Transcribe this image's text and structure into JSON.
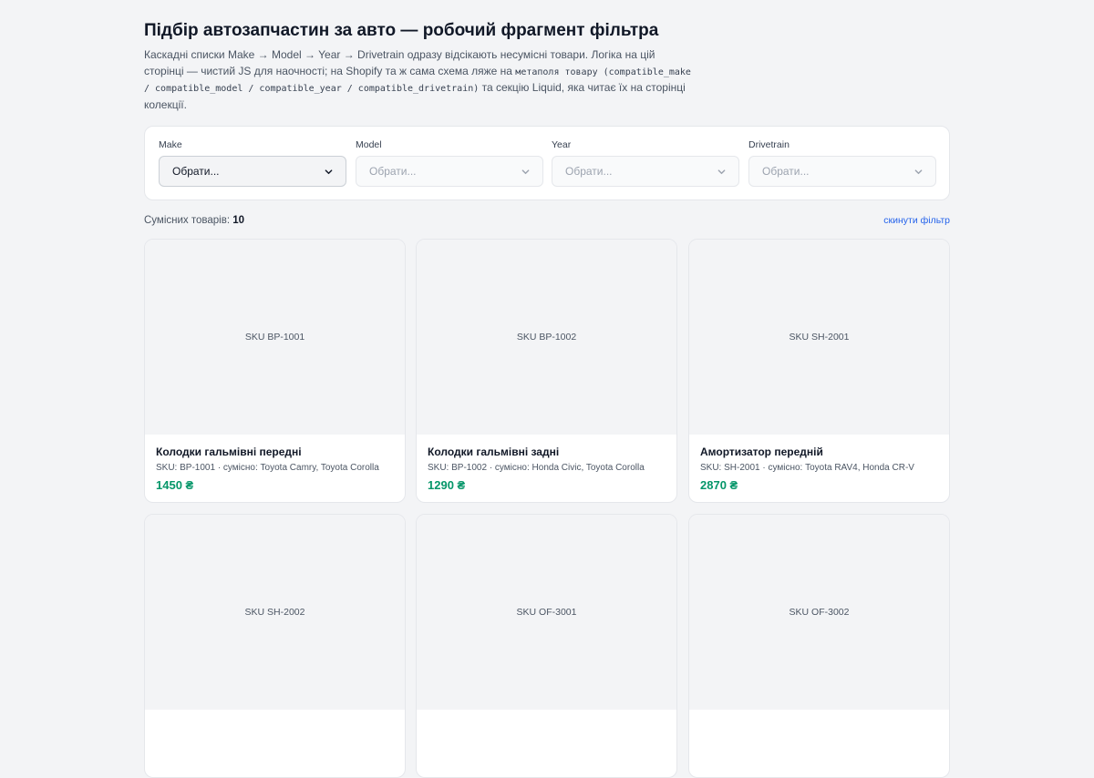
{
  "header": {
    "title": "Підбір автозапчастин за авто — робочий фрагмент фільтра",
    "desc_part1": "Каскадні списки Make → Model → Year → Drivetrain одразу відсікають несумісні товари. Логіка на цій сторінці — чистий JS для наочності; на Shopify та ж сама схема ляже на ",
    "desc_code": "метаполя товару (compatible_make / compatible_model / compatible_year / compatible_drivetrain)",
    "desc_part2": " та секцію Liquid, яка читає їх на сторінці колекції."
  },
  "filters": [
    {
      "label": "Make",
      "value": "Обрати...",
      "active": true
    },
    {
      "label": "Model",
      "value": "Обрати...",
      "active": false
    },
    {
      "label": "Year",
      "value": "Обрати...",
      "active": false
    },
    {
      "label": "Drivetrain",
      "value": "Обрати...",
      "active": false
    }
  ],
  "summary": {
    "label": "Сумісних товарів: ",
    "count": "10",
    "reset": "скинути фільтр"
  },
  "products": [
    {
      "thumb": "SKU BP-1001",
      "title": "Колодки гальмівні передні",
      "meta": "SKU: BP-1001 · сумісно: Toyota Camry, Toyota Corolla",
      "price": "1450 ₴"
    },
    {
      "thumb": "SKU BP-1002",
      "title": "Колодки гальмівні задні",
      "meta": "SKU: BP-1002 · сумісно: Honda Civic, Toyota Corolla",
      "price": "1290 ₴"
    },
    {
      "thumb": "SKU SH-2001",
      "title": "Амортизатор передній",
      "meta": "SKU: SH-2001 · сумісно: Toyota RAV4, Honda CR-V",
      "price": "2870 ₴"
    },
    {
      "thumb": "SKU SH-2002",
      "title": "",
      "meta": "",
      "price": ""
    },
    {
      "thumb": "SKU OF-3001",
      "title": "",
      "meta": "",
      "price": ""
    },
    {
      "thumb": "SKU OF-3002",
      "title": "",
      "meta": "",
      "price": ""
    }
  ],
  "colors": {
    "accent_link": "#2563eb",
    "price": "#059669",
    "background": "#f3f4f6"
  }
}
